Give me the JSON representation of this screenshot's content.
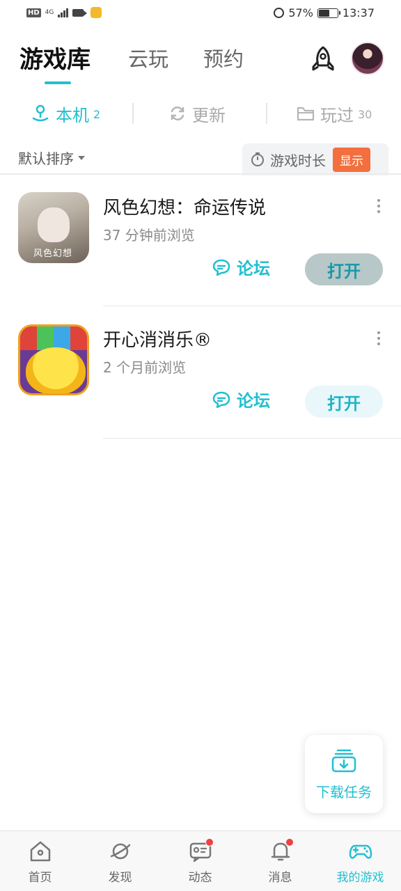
{
  "status_bar": {
    "left_badge": "HD",
    "network": "4G",
    "battery_percent": "57%",
    "time": "13:37"
  },
  "header": {
    "tabs": [
      {
        "label": "游戏库",
        "active": true
      },
      {
        "label": "云玩",
        "active": false
      },
      {
        "label": "预约",
        "active": false
      }
    ]
  },
  "sub_tabs": [
    {
      "label": "本机",
      "count": "2",
      "icon": "local-device-icon",
      "active": true
    },
    {
      "label": "更新",
      "count": "",
      "icon": "refresh-icon",
      "active": false
    },
    {
      "label": "玩过",
      "count": "30",
      "icon": "folder-icon",
      "active": false
    }
  ],
  "sort": {
    "label": "默认排序",
    "duration_label": "游戏时长",
    "show_badge": "显示"
  },
  "games": [
    {
      "title": "风色幻想：命运传说",
      "subtitle": "37 分钟前浏览",
      "icon_text": "风色幻想",
      "forum_label": "论坛",
      "open_label": "打开"
    },
    {
      "title": "开心消消乐®",
      "subtitle": "2 个月前浏览",
      "forum_label": "论坛",
      "open_label": "打开"
    }
  ],
  "download_task": {
    "label": "下载任务"
  },
  "bottom_nav": [
    {
      "label": "首页",
      "icon": "home-icon",
      "dot": false,
      "active": false
    },
    {
      "label": "发现",
      "icon": "planet-icon",
      "dot": false,
      "active": false
    },
    {
      "label": "动态",
      "icon": "feed-icon",
      "dot": true,
      "active": false
    },
    {
      "label": "消息",
      "icon": "bell-icon",
      "dot": true,
      "active": false
    },
    {
      "label": "我的游戏",
      "icon": "gamepad-icon",
      "dot": false,
      "active": true
    }
  ],
  "colors": {
    "accent": "#22bfd0",
    "badge_orange": "#f36f3d",
    "notification_red": "#f04040"
  }
}
